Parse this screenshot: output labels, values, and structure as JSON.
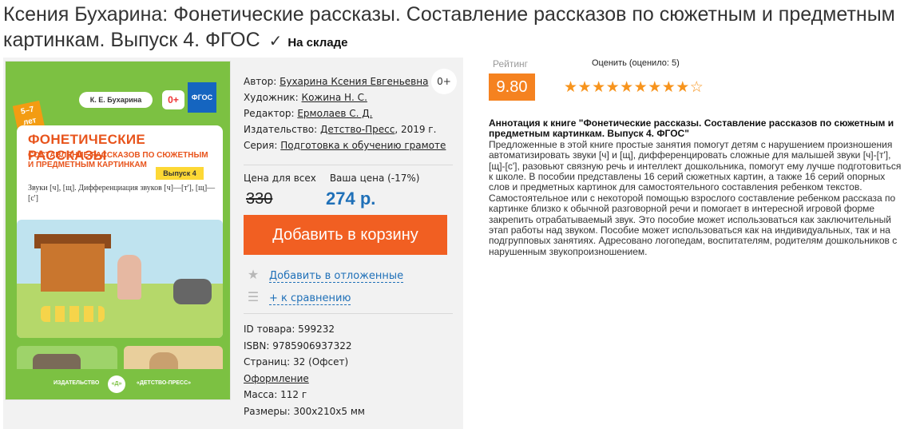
{
  "header": {
    "title": "Ксения Бухарина: Фонетические рассказы. Составление рассказов по сюжетным и предметным картинкам. Выпуск 4. ФГОС",
    "check_glyph": "✓",
    "stock_status": "На складе"
  },
  "cover": {
    "author": "К. Е. Бухарина",
    "age": "0+",
    "fgos": "ФГОС",
    "age_range": "5–7 лет",
    "title": "ФОНЕТИЧЕСКИЕ РАССКАЗЫ",
    "subtitle": "СОСТАВЛЕНИЕ РАССКАЗОВ ПО СЮЖЕТНЫМ И ПРЕДМЕТНЫМ КАРТИНКАМ",
    "issue": "Выпуск 4",
    "sounds": "Звуки [ч], [щ]. Дифференциация звуков [ч]—[т'], [щ]—[с']",
    "publisher_left": "ИЗДАТЕЛЬСТВО",
    "publisher_logo": "«Д»",
    "publisher_right": "«ДЕТСТВО-ПРЕСС»"
  },
  "details": {
    "author_label": "Автор:",
    "author": "Бухарина Ксения Евгеньевна",
    "artist_label": "Художник:",
    "artist": "Кожина Н. С.",
    "editor_label": "Редактор:",
    "editor": "Ермолаев С. Д.",
    "publisher_label": "Издательство:",
    "publisher": "Детство-Пресс",
    "year": ", 2019 г.",
    "series_label": "Серия:",
    "series": "Подготовка к обучению грамоте",
    "age_rating": "0+"
  },
  "price": {
    "all_label": "Цена для всех",
    "your_label": "Ваша цена (-17%)",
    "old": "330",
    "new": "274 р."
  },
  "actions": {
    "add_to_cart": "Добавить в корзину",
    "wishlist": "Добавить в отложенные",
    "compare": "+ к сравнению",
    "wishlist_icon": "star-icon",
    "compare_icon": "list-icon"
  },
  "specs": {
    "id": "ID товара: 599232",
    "isbn": "ISBN: 9785906937322",
    "pages": "Страниц: 32 (Офсет)",
    "design": "Оформление",
    "mass": "Масса: 112 г",
    "size": "Размеры: 300x210x5 мм"
  },
  "rating": {
    "label": "Рейтинг",
    "value": "9.80",
    "rate_label": "Оценить (оценило: 5)",
    "stars": "★★★★★★★★★☆"
  },
  "annotation": {
    "title": "Аннотация к книге \"Фонетические рассказы. Составление рассказов по сюжетным и предметным картинкам. Выпуск 4. ФГОС\"",
    "text": "Предложенные в этой книге простые занятия помогут детям с нарушением произношения автоматизировать звуки [ч] и [щ], дифференцировать сложные для малышей звуки [ч]-[т'], [щ]-[с'], разовьют связную речь и интеллект дошкольника, помогут ему лучше подготовиться к школе. В пособии представлены 16 серий сюжетных картин, а также 16 серий опорных слов и предметных картинок для самостоятельного составления ребенком текстов. Самостоятельное или с некоторой помощью взрослого составление ребенком рассказа по картинке близко к обычной разговорной речи и помогает в интересной игровой форме закрепить отрабатываемый звук. Это пособие может использоваться как заключительный этап работы над звуком. Пособие может использоваться как на индивидуальных, так и на подгрупповых занятиях. Адресовано логопедам, воспитателям, родителям дошкольников с нарушенным звукопроизношением."
  }
}
